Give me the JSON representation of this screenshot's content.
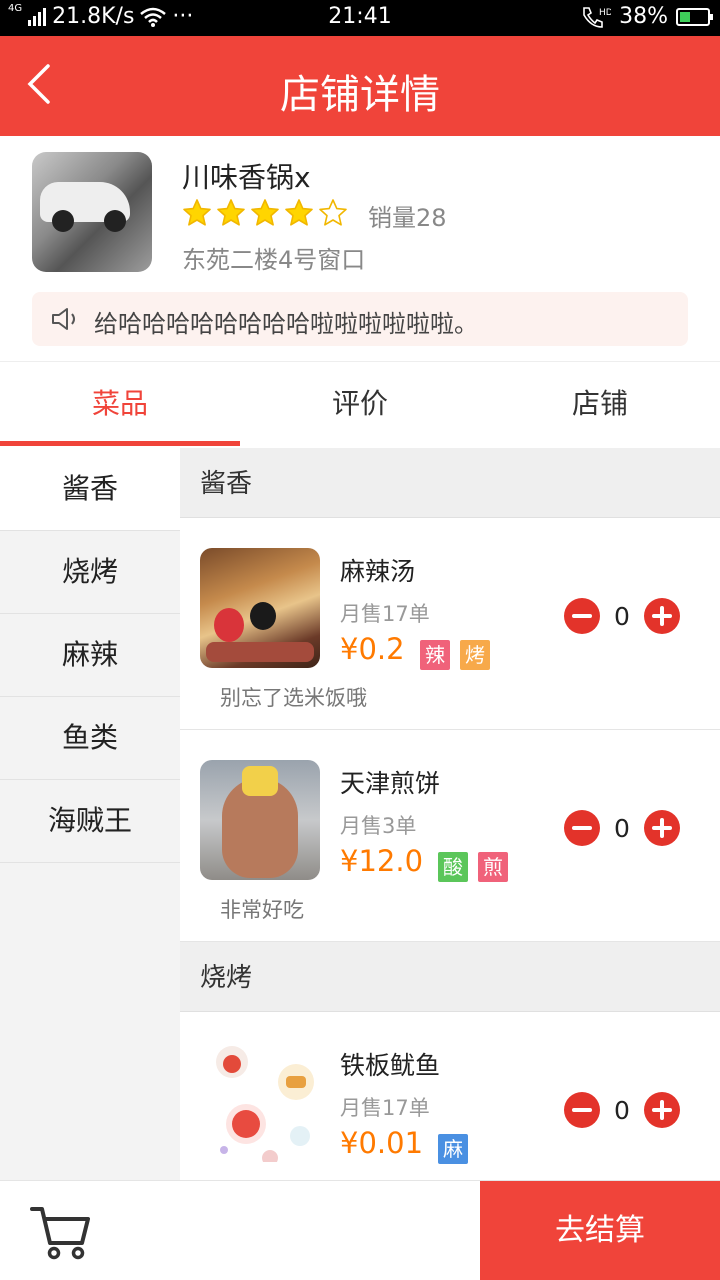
{
  "status_bar": {
    "network": "4G",
    "speed": "21.8K/s",
    "dots": "···",
    "time": "21:41",
    "hd": "HD",
    "battery": "38%",
    "battery_level": 0.38
  },
  "header": {
    "back_icon": "chevron-left-icon",
    "title": "店铺详情"
  },
  "store": {
    "name": "川味香锅x",
    "rating": 4,
    "rating_max": 5,
    "sales": "销量28",
    "address": "东苑二楼4号窗口",
    "notice": "给哈哈哈哈哈哈哈哈啦啦啦啦啦啦。"
  },
  "tabs": [
    {
      "label": "菜品",
      "active": true
    },
    {
      "label": "评价",
      "active": false
    },
    {
      "label": "店铺",
      "active": false
    }
  ],
  "categories": [
    {
      "label": "酱香",
      "active": true
    },
    {
      "label": "烧烤",
      "active": false
    },
    {
      "label": "麻辣",
      "active": false
    },
    {
      "label": "鱼类",
      "active": false
    },
    {
      "label": "海贼王",
      "active": false
    }
  ],
  "sections": [
    {
      "title": "酱香",
      "items": [
        {
          "name": "麻辣汤",
          "sold": "月售17单",
          "price": "¥0.2",
          "tags": [
            {
              "text": "辣",
              "color": "#f0627a"
            },
            {
              "text": "烤",
              "color": "#f7a94a"
            }
          ],
          "note": "别忘了选米饭哦",
          "qty": "0"
        },
        {
          "name": "天津煎饼",
          "sold": "月售3单",
          "price": "¥12.0",
          "tags": [
            {
              "text": "酸",
              "color": "#5bc65a"
            },
            {
              "text": "煎",
              "color": "#f0627a"
            }
          ],
          "note": "非常好吃",
          "qty": "0"
        }
      ]
    },
    {
      "title": "烧烤",
      "items": [
        {
          "name": "铁板鱿鱼",
          "sold": "月售17单",
          "price": "¥0.01",
          "tags": [
            {
              "text": "麻",
              "color": "#4a90e2"
            }
          ],
          "note": "",
          "qty": "0"
        }
      ]
    }
  ],
  "bottom": {
    "cart_icon": "cart-icon",
    "checkout": "去结算"
  },
  "colors": {
    "brand": "#f0443a",
    "price": "#ff7a00",
    "stepper": "#e3332a"
  }
}
